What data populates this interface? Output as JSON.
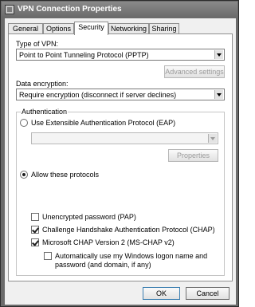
{
  "window": {
    "title": "VPN Connection Properties"
  },
  "tabs": [
    {
      "label": "General",
      "selected": false
    },
    {
      "label": "Options",
      "selected": false
    },
    {
      "label": "Security",
      "selected": true
    },
    {
      "label": "Networking",
      "selected": false
    },
    {
      "label": "Sharing",
      "selected": false
    }
  ],
  "vpn_type": {
    "label": "Type of VPN:",
    "value": "Point to Point Tunneling Protocol (PPTP)"
  },
  "advanced_settings_label": "Advanced settings",
  "data_encryption": {
    "label": "Data encryption:",
    "value": "Require encryption (disconnect if server declines)"
  },
  "authentication": {
    "legend": "Authentication",
    "eap_option": {
      "label": "Use Extensible Authentication Protocol (EAP)",
      "selected": false
    },
    "eap_select_value": "",
    "properties_label": "Properties",
    "allow_option": {
      "label": "Allow these protocols",
      "selected": true
    },
    "protocols": [
      {
        "label": "Unencrypted password (PAP)",
        "checked": false
      },
      {
        "label": "Challenge Handshake Authentication Protocol (CHAP)",
        "checked": true
      },
      {
        "label": "Microsoft CHAP Version 2 (MS-CHAP v2)",
        "checked": true
      }
    ],
    "auto_logon": {
      "line1": "Automatically use my Windows logon name and",
      "line2": "password (and domain, if any)",
      "checked": false
    }
  },
  "footer": {
    "ok_label": "OK",
    "cancel_label": "Cancel"
  }
}
